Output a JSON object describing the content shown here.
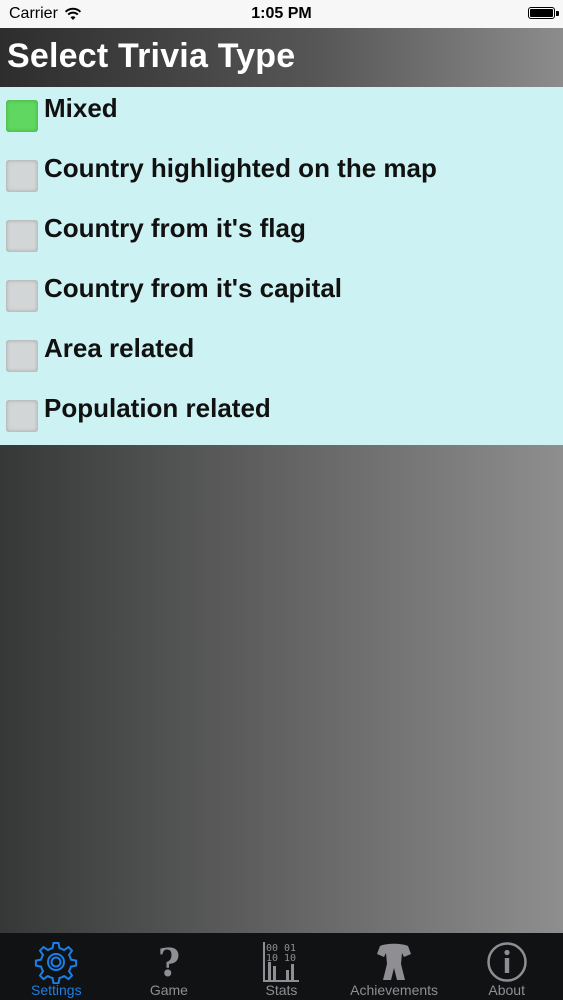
{
  "status_bar": {
    "carrier": "Carrier",
    "time": "1:05 PM",
    "battery_level": 1.0
  },
  "header": {
    "title": "Select Trivia Type"
  },
  "options": [
    {
      "label": "Mixed",
      "selected": true
    },
    {
      "label": "Country highlighted on the map",
      "selected": false
    },
    {
      "label": "Country from it's flag",
      "selected": false
    },
    {
      "label": "Country from it's capital",
      "selected": false
    },
    {
      "label": "Area related",
      "selected": false
    },
    {
      "label": "Population related",
      "selected": false
    }
  ],
  "tab_bar": {
    "active": "Settings",
    "tabs": [
      {
        "label": "Settings",
        "icon": "gear-icon"
      },
      {
        "label": "Game",
        "icon": "question-mark-icon"
      },
      {
        "label": "Stats",
        "icon": "binary-chart-icon"
      },
      {
        "label": "Achievements",
        "icon": "trophy-icon"
      },
      {
        "label": "About",
        "icon": "info-icon"
      }
    ],
    "stats_icon_digits": [
      "00",
      "01",
      "10",
      "10"
    ]
  },
  "colors": {
    "selected_check": "#60d760",
    "unselected_check": "#d3d6d6",
    "panel_bg": "#cdf2f3",
    "tab_active": "#1a7fe8",
    "tab_inactive": "#8e8e93"
  }
}
